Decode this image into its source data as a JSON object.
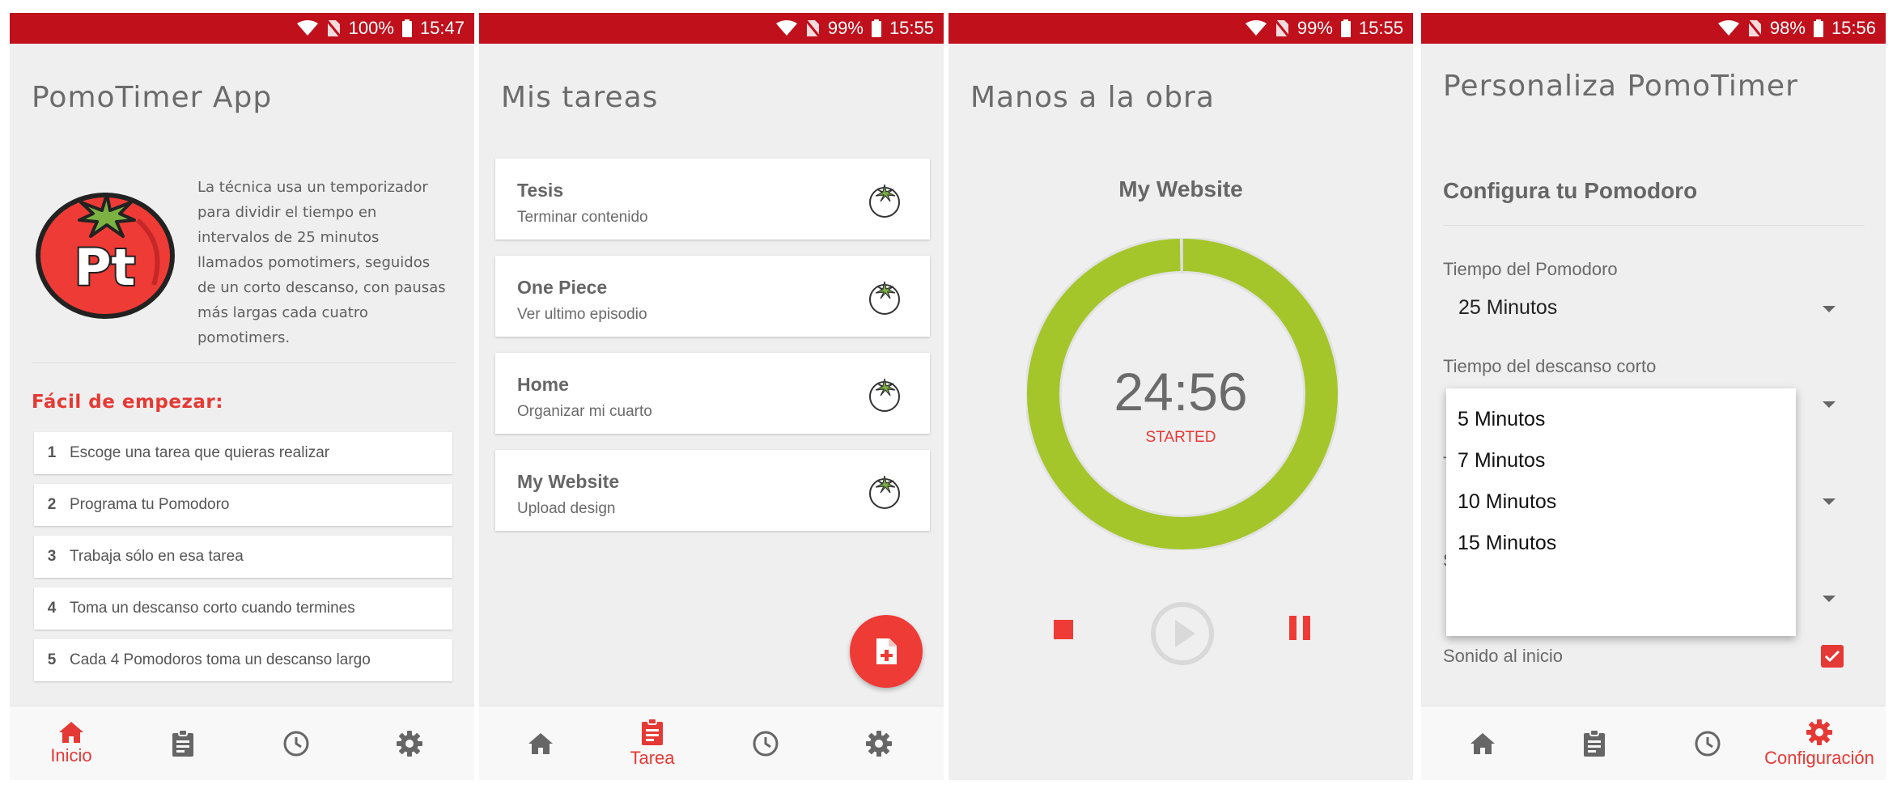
{
  "colors": {
    "accent": "#e53935",
    "statusbar": "#c0101c",
    "timer_ring": "#a4c62b",
    "background": "#efefef"
  },
  "screens": [
    {
      "status": {
        "battery": "100%",
        "time": "15:47"
      },
      "title": "PomoTimer App",
      "logo_text": "Pt",
      "description": "La técnica usa un temporizador para dividir el tiempo en intervalos de 25 minutos llamados pomotimers, seguidos de un corto descanso, con pausas más largas cada cuatro pomotimers.",
      "section_title": "Fácil de empezar:",
      "steps": [
        {
          "num": "1",
          "text": "Escoge una tarea que quieras realizar"
        },
        {
          "num": "2",
          "text": "Programa tu Pomodoro"
        },
        {
          "num": "3",
          "text": "Trabaja sólo en esa tarea"
        },
        {
          "num": "4",
          "text": "Toma un descanso corto cuando termines"
        },
        {
          "num": "5",
          "text": "Cada 4 Pomodoros toma un descanso largo"
        }
      ],
      "active_nav_label": "Inicio"
    },
    {
      "status": {
        "battery": "99%",
        "time": "15:55"
      },
      "title": "Mis tareas",
      "tasks": [
        {
          "title": "Tesis",
          "subtitle": "Terminar contenido"
        },
        {
          "title": "One Piece",
          "subtitle": "Ver ultimo episodio"
        },
        {
          "title": "Home",
          "subtitle": "Organizar mi cuarto"
        },
        {
          "title": "My Website",
          "subtitle": "Upload design"
        }
      ],
      "fab_icon": "add-note-icon",
      "active_nav_label": "Tarea"
    },
    {
      "status": {
        "battery": "99%",
        "time": "15:55"
      },
      "title": "Manos a la obra",
      "task_name": "My Website",
      "time": "24:56",
      "state": "STARTED",
      "progress_remaining": 0.997
    },
    {
      "status": {
        "battery": "98%",
        "time": "15:56"
      },
      "title": "Personaliza PomoTimer",
      "subtitle": "Configura tu Pomodoro",
      "pomodoro_label": "Tiempo del Pomodoro",
      "pomodoro_value": "25 Minutos",
      "short_break_label": "Tiempo del descanso corto",
      "dropdown_options": [
        "5 Minutos",
        "7 Minutos",
        "10 Minutos",
        "15 Minutos"
      ],
      "partial_label_1": "T",
      "partial_label_2": "S",
      "sound_label": "Sonido al inicio",
      "sound_checked": true,
      "active_nav_label": "Configuración"
    }
  ],
  "nav_icons": [
    "home-icon",
    "clipboard-icon",
    "clock-icon",
    "gear-icon"
  ]
}
